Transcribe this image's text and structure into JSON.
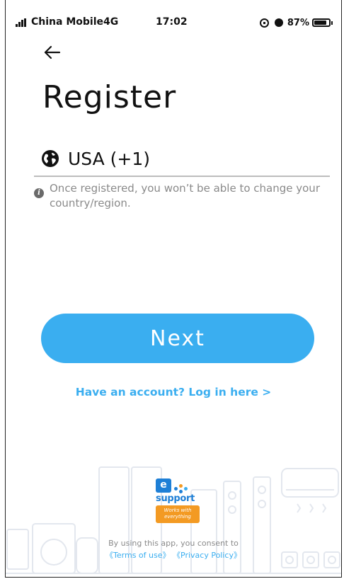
{
  "status_bar": {
    "carrier": "China Mobile4G",
    "time": "17:02",
    "battery_percent": "87%",
    "battery_level": 0.87
  },
  "header": {
    "back_icon": "arrow-left-icon",
    "title": "Register"
  },
  "region": {
    "icon": "globe-icon",
    "label": "USA (+1)"
  },
  "note": {
    "icon": "info-icon",
    "text": "Once registered, you won’t be able to change your country/region."
  },
  "actions": {
    "next_label": "Next",
    "login_link": "Have an account? Log in here >"
  },
  "footer": {
    "logo": {
      "letter": "e",
      "word": "support",
      "badge": "Works with everything"
    },
    "consent_text": "By using this app, you consent to",
    "terms_label": "《Terms of use》",
    "privacy_label": "《Privacy Policy》"
  },
  "colors": {
    "accent": "#3aaef0",
    "brand_blue": "#1e7fd6",
    "brand_orange": "#f39a23",
    "muted_text": "#8a8a8a"
  }
}
